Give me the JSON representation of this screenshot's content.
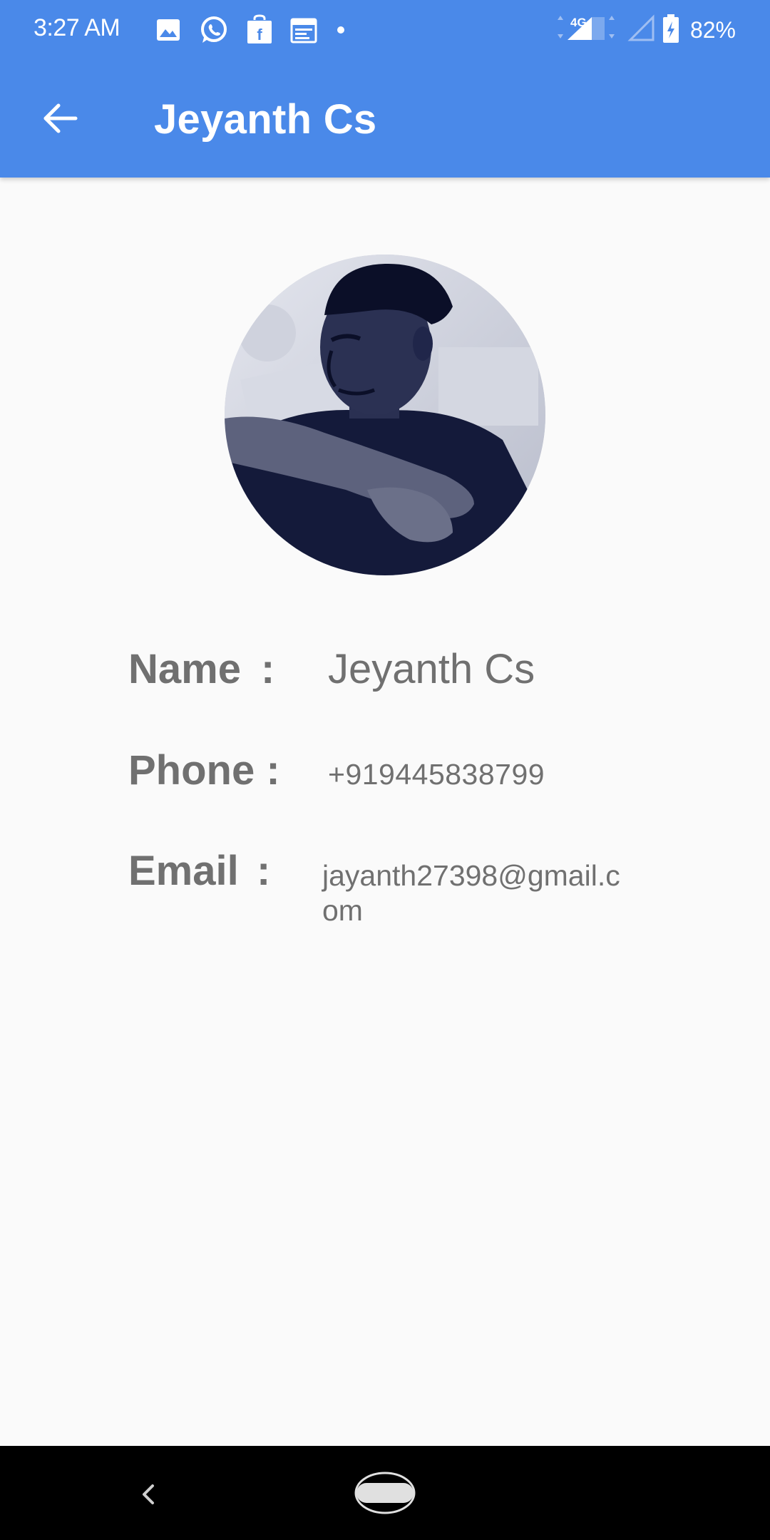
{
  "status_bar": {
    "time": "3:27 AM",
    "network": "4G",
    "battery": "82%",
    "icons_left": [
      "image-icon",
      "whatsapp-icon",
      "shop-icon",
      "calendar-icon",
      "notification-dot-icon"
    ],
    "icons_right": [
      "4g-signal-icon",
      "signal-icon",
      "battery-charging-icon"
    ]
  },
  "toolbar": {
    "title": "Jeyanth Cs",
    "back_icon": "arrow-back-icon"
  },
  "profile": {
    "avatar_icon": "profile-photo",
    "name_label": "Name",
    "name_colon": ":",
    "name_value": "Jeyanth Cs",
    "phone_label": "Phone :",
    "phone_value": "+919445838799",
    "email_label": "Email",
    "email_colon": ":",
    "email_value": "jayanth27398@gmail.com"
  },
  "nav_bar": {
    "back_icon": "nav-back-icon",
    "home_icon": "nav-home-icon"
  },
  "colors": {
    "primary": "#4a89e9",
    "background": "#fafafa",
    "text": "#707070",
    "navbar": "#000000"
  }
}
